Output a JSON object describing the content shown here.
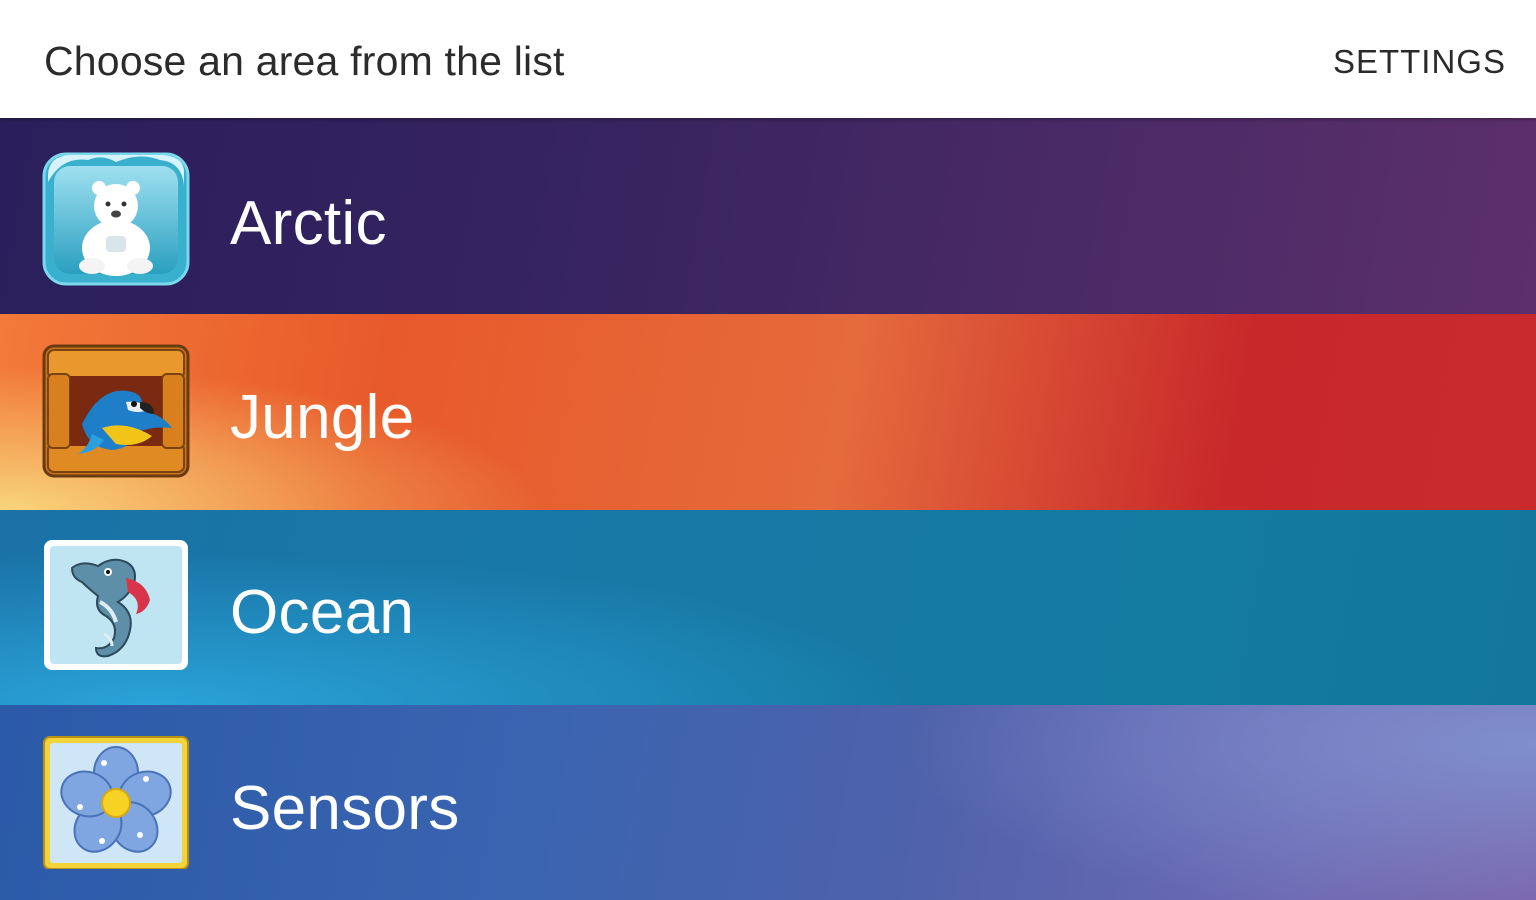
{
  "header": {
    "title": "Choose an area from the list",
    "settings_label": "SETTINGS"
  },
  "areas": [
    {
      "label": "Arctic",
      "icon": "polar-bear-icon"
    },
    {
      "label": "Jungle",
      "icon": "parrot-icon"
    },
    {
      "label": "Ocean",
      "icon": "seahorse-icon"
    },
    {
      "label": "Sensors",
      "icon": "flower-icon"
    }
  ],
  "colors": {
    "arctic": "#35235f",
    "jungle": "#e85a2a",
    "ocean": "#1879a7",
    "sensors": "#3a64b0",
    "header_bg": "#ffffff"
  }
}
